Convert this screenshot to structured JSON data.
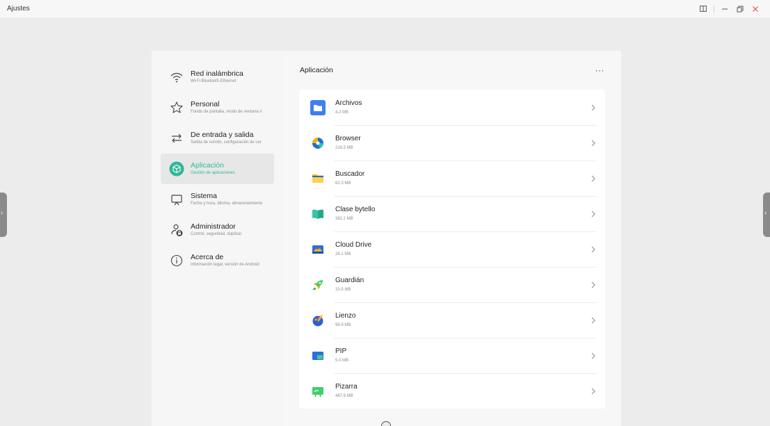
{
  "window": {
    "title": "Ajustes"
  },
  "sidebar": {
    "items": [
      {
        "title": "Red inalámbrica",
        "subtitle": "Wi-Fi Bluetooth Ethernet",
        "icon": "wifi-icon"
      },
      {
        "title": "Personal",
        "subtitle": "Fondo de pantalla, modo de ventana n",
        "icon": "star-icon"
      },
      {
        "title": "De entrada y salida",
        "subtitle": "Salida de sonido, configuración de car",
        "icon": "swap-arrows-icon"
      },
      {
        "title": "Aplicación",
        "subtitle": "Gestión de aplicaciones",
        "icon": "cube-icon",
        "active": true
      },
      {
        "title": "Sistema",
        "subtitle": "Fecha y hora, idioma, almacenamiento",
        "icon": "monitor-icon"
      },
      {
        "title": "Administrador",
        "subtitle": "Control, seguridad, duplicar",
        "icon": "admin-lock-icon"
      },
      {
        "title": "Acerca de",
        "subtitle": "Información legal, versión de Android",
        "icon": "info-icon"
      }
    ]
  },
  "content": {
    "title": "Aplicación",
    "more_label": "···",
    "apps": [
      {
        "name": "Archivos",
        "size": "4.2 MB",
        "icon": "folder-icon"
      },
      {
        "name": "Browser",
        "size": "216.5 MB",
        "icon": "browser-icon"
      },
      {
        "name": "Buscador",
        "size": "62.3 MB",
        "icon": "finder-folder-icon"
      },
      {
        "name": "Clase bytello",
        "size": "382.2 MB",
        "icon": "book-icon"
      },
      {
        "name": "Cloud Drive",
        "size": "26.1 MB",
        "icon": "cloud-drive-icon"
      },
      {
        "name": "Guardián",
        "size": "15.5 MB",
        "icon": "rocket-icon"
      },
      {
        "name": "Lienzo",
        "size": "96.9 MB",
        "icon": "palette-icon"
      },
      {
        "name": "PIP",
        "size": "5.0 MB",
        "icon": "pip-icon"
      },
      {
        "name": "Pizarra",
        "size": "487.6 MB",
        "icon": "whiteboard-icon"
      }
    ]
  },
  "colors": {
    "accent": "#2fb897",
    "background": "#ececec"
  }
}
